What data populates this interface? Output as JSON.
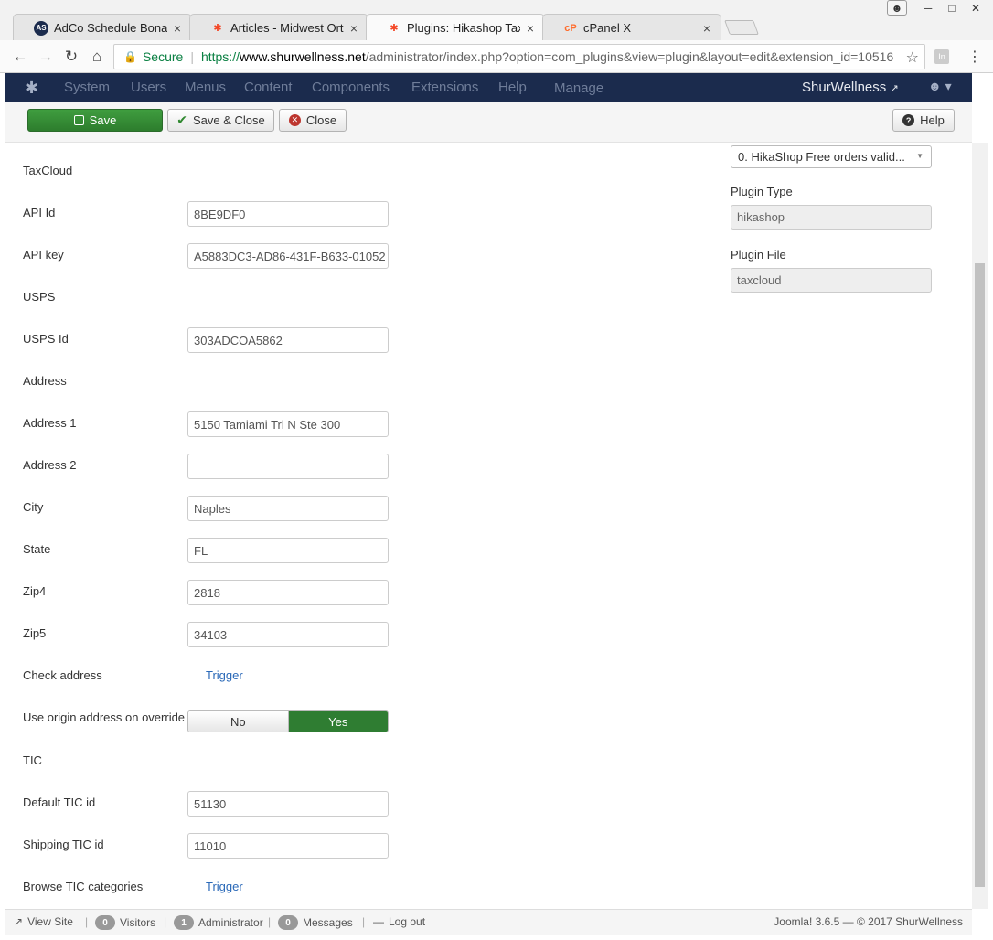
{
  "browser": {
    "tabs": [
      {
        "title": "AdCo Schedule Bonanza",
        "favicon": "adco-favicon"
      },
      {
        "title": "Articles - Midwest Orthop",
        "favicon": "joomla-favicon"
      },
      {
        "title": "Plugins: Hikashop TaxClo",
        "favicon": "joomla-favicon"
      },
      {
        "title": "cPanel X",
        "favicon": "cpanel-favicon"
      }
    ],
    "close_glyph": "×",
    "secure_label": "Secure",
    "url_scheme": "https://",
    "url_host": "www.shurwellness.net",
    "url_path": "/administrator/index.php?option=com_plugins&view=plugin&layout=edit&extension_id=10516"
  },
  "navbar": {
    "menu": [
      "System",
      "Users",
      "Menus",
      "Content",
      "Components",
      "Extensions",
      "Help",
      "Manage"
    ],
    "site_name": "ShurWellness",
    "colors": {
      "background": "#1b2b4d",
      "menu_text": "#6f7d99"
    }
  },
  "toolbar": {
    "save_label": "Save",
    "save_close_label": "Save & Close",
    "close_label": "Close",
    "help_label": "Help"
  },
  "form": {
    "section_taxcloud": "TaxCloud",
    "api_id_label": "API Id",
    "api_id_value": "8BE9DF0",
    "api_key_label": "API key",
    "api_key_value": "A5883DC3-AD86-431F-B633-01052",
    "section_usps": "USPS",
    "usps_id_label": "USPS Id",
    "usps_id_value": "303ADCOA5862",
    "section_address": "Address",
    "address1_label": "Address 1",
    "address1_value": "5150 Tamiami Trl N Ste 300",
    "address2_label": "Address 2",
    "address2_value": "",
    "city_label": "City",
    "city_value": "Naples",
    "state_label": "State",
    "state_value": "FL",
    "zip4_label": "Zip4",
    "zip4_value": "2818",
    "zip5_label": "Zip5",
    "zip5_value": "34103",
    "check_address_label": "Check address",
    "check_address_link": "Trigger",
    "use_origin_label": "Use origin address on override",
    "toggle_no": "No",
    "toggle_yes": "Yes",
    "toggle_selected": "Yes",
    "section_tic": "TIC",
    "default_tic_label": "Default TIC id",
    "default_tic_value": "51130",
    "shipping_tic_label": "Shipping TIC id",
    "shipping_tic_value": "11010",
    "browse_tic_label": "Browse TIC categories",
    "browse_tic_link": "Trigger"
  },
  "sidebar": {
    "ordering_value": "0. HikaShop Free orders valid...",
    "plugin_type_label": "Plugin Type",
    "plugin_type_value": "hikashop",
    "plugin_file_label": "Plugin File",
    "plugin_file_value": "taxcloud"
  },
  "statusbar": {
    "view_site": "View Site",
    "visitors_count": "0",
    "visitors_label": "Visitors",
    "admin_count": "1",
    "admin_label": "Administrator",
    "messages_count": "0",
    "messages_label": "Messages",
    "logout_label": "Log out",
    "version": "Joomla! 3.6.5 — © 2017 ShurWellness"
  }
}
